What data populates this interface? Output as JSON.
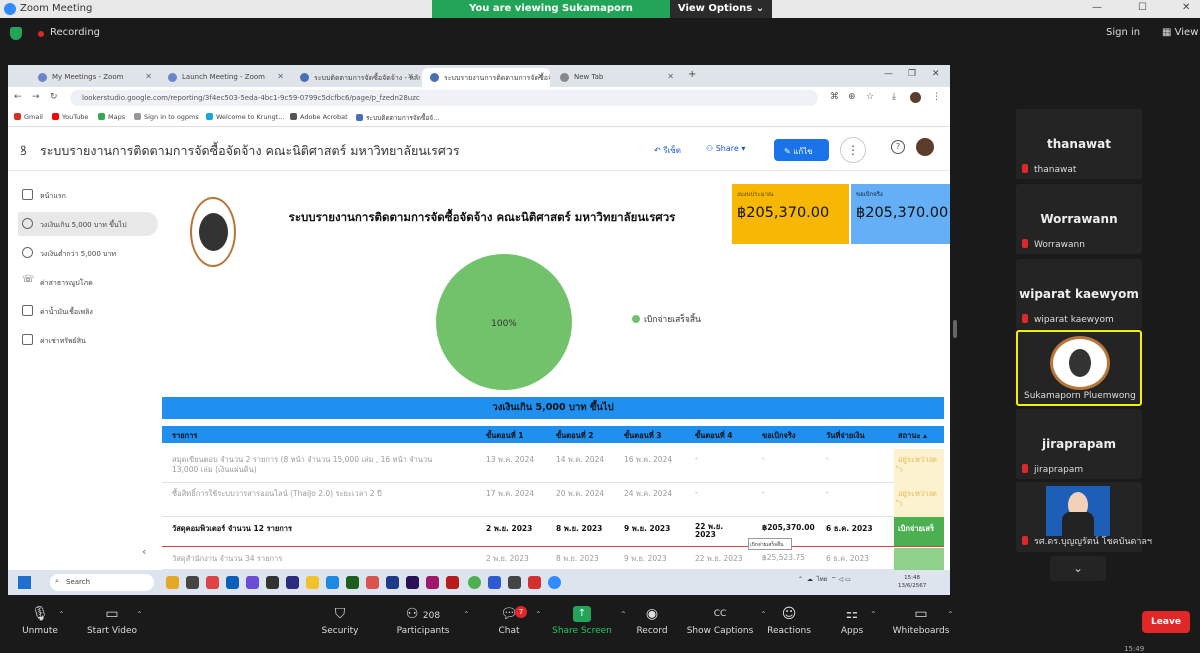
{
  "zoom": {
    "window_title": "Zoom Meeting",
    "share_banner": "You are viewing Sukamaporn Pluemwong's screen",
    "view_options": "View Options",
    "recording_label": "Recording",
    "sign_in": "Sign in",
    "view_label": "View",
    "leave": "Leave",
    "toolbar": {
      "unmute": "Unmute",
      "start_video": "Start Video",
      "security": "Security",
      "participants": "Participants",
      "participants_count": "208",
      "chat": "Chat",
      "chat_badge": "7",
      "share_screen": "Share Screen",
      "record": "Record",
      "show_captions": "Show Captions",
      "reactions": "Reactions",
      "apps": "Apps",
      "whiteboards": "Whiteboards"
    },
    "participants": [
      {
        "display": "thanawat",
        "name": "thanawat"
      },
      {
        "display": "Worrawann",
        "name": "Worrawann"
      },
      {
        "display": "wiparat kaewyom",
        "name": "wiparat kaewyom"
      },
      {
        "display": "",
        "name": "Sukamaporn Pluemwong"
      },
      {
        "display": "jiraprapam",
        "name": "jiraprapam"
      },
      {
        "display": "",
        "name": "รศ.ดร.บุญญรัตน์ โชคบันดาลฯ"
      }
    ],
    "bottom_clock": "15:49"
  },
  "browser": {
    "tabs": [
      {
        "label": "My Meetings - Zoom"
      },
      {
        "label": "Launch Meeting - Zoom"
      },
      {
        "label": "ระบบติดตามการจัดซื้อจัดจ้าง - หลัก"
      },
      {
        "label": "ระบบรายงานการติดตามการจัดซื้อจัด"
      },
      {
        "label": "New Tab"
      }
    ],
    "url": "lookerstudio.google.com/reporting/3f4ec503-5eda-4bc1-9c59-0799c5dcfbc6/page/p_fzedn28uzc",
    "bookmarks": [
      "Gmail",
      "YouTube",
      "Maps",
      "Sign in to ogpms",
      "Welcome to Krungt...",
      "Adobe Acrobat",
      "ระบบติดตามการจัดซื้อจั..."
    ]
  },
  "looker": {
    "title": "ระบบรายงานการติดตามการจัดซื้อจัดจ้าง คณะนิติศาสตร์ มหาวิทยาลัยนเรศวร",
    "reset_label": "รีเซ็ต",
    "share_label": "Share",
    "edit_label": "แก้ไข",
    "sidebar": [
      "หน้าแรก",
      "วงเงินเกิน 5,000 บาท ขึ้นไป",
      "วงเงินต่ำกว่า 5,000 บาท",
      "ค่าสาธารณูปโภค",
      "ค่าน้ำมันเชื้อเพลิง",
      "ค่าเช่าทรัพย์สิน"
    ]
  },
  "report": {
    "title": "ระบบรายงานการติดตามการจัดซื้อจัดจ้าง คณะนิติศาสตร์ มหาวิทยาลัยนเรศวร",
    "cards": {
      "budget_label": "งบงบประมาณ",
      "budget_value": "฿205,370.00",
      "paid_label": "ขอเบิกจริง",
      "paid_value": "฿205,370.00"
    },
    "pie": {
      "label": "100%",
      "legend": "เบิกจ่ายเสร็จสิ้น",
      "value": 100,
      "color": "#71c26b"
    },
    "section_title": "วงเงินเกิน 5,000 บาท ขึ้นไป",
    "columns": [
      "รายการ",
      "ขั้นตอนที่ 1",
      "ขั้นตอนที่ 2",
      "ขั้นตอนที่ 3",
      "ขั้นตอนที่ 4",
      "ขอเบิกจริง",
      "วันที่จ่ายเงิน",
      "สถานะ"
    ],
    "rows": [
      {
        "item": "สมุดเขียนตอบ จำนวน 2 รายการ (8 หน้า จำนวน 15,000 เล่ม , 16 หน้า จำนวน",
        "item2": "13,000 เล่ม (เงินแผ่นดิน)",
        "s1": "13 พ.ค. 2024",
        "s2": "14 พ.ค. 2024",
        "s3": "16 พ.ค. 2024",
        "s4": "-",
        "amount": "-",
        "paid": "-",
        "status": "อยู่ระหว่างด",
        "status2": "ำ"
      },
      {
        "item": "ซื้อสิทธิ์การใช้ระบบวารสารออนไลน์ (ThaiJo 2.0) ระยะเวลา 2 ปี",
        "item2": "",
        "s1": "17 พ.ค. 2024",
        "s2": "20 พ.ค. 2024",
        "s3": "24 พ.ค. 2024",
        "s4": "-",
        "amount": "-",
        "paid": "-",
        "status": "อยู่ระหว่างด",
        "status2": "ำ"
      },
      {
        "item": "วัสดุคอมพิวเตอร์ จำนวน 12 รายการ",
        "item2": "",
        "s1": "2 พ.ย. 2023",
        "s2": "8 พ.ย. 2023",
        "s3": "9 พ.ย. 2023",
        "s4": "22 พ.ย.",
        "s4b": "2023",
        "amount": "฿205,370.00",
        "paid": "6 ธ.ค. 2023",
        "status": "เบิกจ่ายเสร็",
        "status2": ""
      },
      {
        "item": "วัสดุสำนักงาน จำนวน 34 รายการ",
        "item2": "",
        "s1": "2 พ.ย. 2023",
        "s2": "8 พ.ย. 2023",
        "s3": "9 พ.ย. 2023",
        "s4": "22 พ.ย. 2023",
        "amount": "฿25,523.75",
        "paid": "6 ธ.ค. 2023",
        "status": "",
        "status2": ""
      }
    ],
    "tooltip": "เบิกจ่ายเสร็จสิ้น"
  },
  "taskbar": {
    "search": "Search",
    "clock_time": "15:48",
    "clock_date": "13/6/2567",
    "lang": "ไทย"
  }
}
